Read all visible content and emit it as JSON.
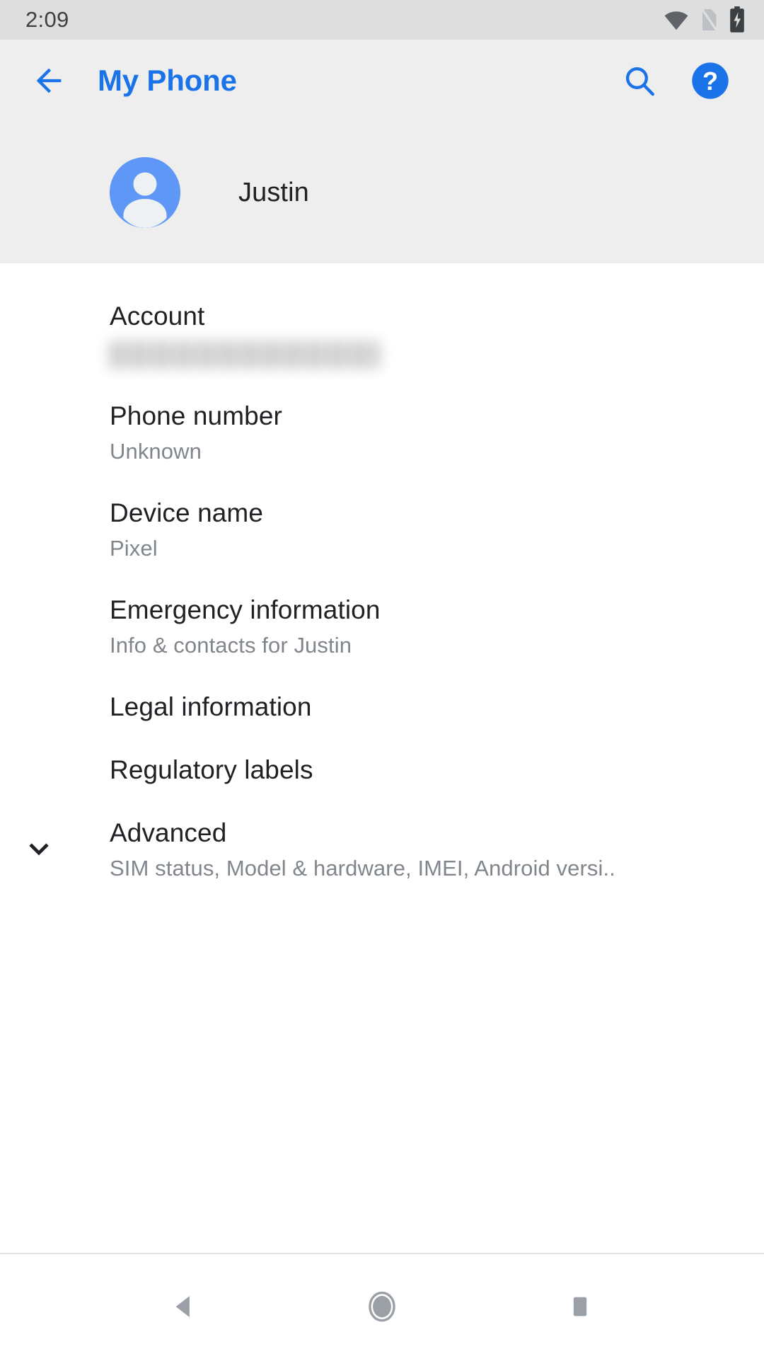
{
  "status_bar": {
    "time": "2:09",
    "icons": [
      {
        "name": "wifi-icon",
        "label": "Wi-Fi connected"
      },
      {
        "name": "sim-off-icon",
        "label": "No SIM"
      },
      {
        "name": "battery-charging-icon",
        "label": "Battery charging"
      }
    ]
  },
  "app_bar": {
    "back_label": "Navigate up",
    "title": "My Phone",
    "search_label": "Search",
    "help_label": "Help",
    "title_color": "#1a73e8"
  },
  "profile": {
    "avatar_name": "person-avatar",
    "name": "Justin",
    "avatar_color": "#5e97f6"
  },
  "settings": {
    "rows": [
      {
        "name": "account",
        "title": "Account",
        "subtitle": "",
        "redacted": true,
        "chevron": false
      },
      {
        "name": "phone-number",
        "title": "Phone number",
        "subtitle": "Unknown",
        "redacted": false,
        "chevron": false
      },
      {
        "name": "device-name",
        "title": "Device name",
        "subtitle": "Pixel",
        "redacted": false,
        "chevron": false
      },
      {
        "name": "emergency-information",
        "title": "Emergency information",
        "subtitle": "Info & contacts for Justin",
        "redacted": false,
        "chevron": false
      },
      {
        "name": "legal-information",
        "title": "Legal information",
        "subtitle": "",
        "redacted": false,
        "chevron": false
      },
      {
        "name": "regulatory-labels",
        "title": "Regulatory labels",
        "subtitle": "",
        "redacted": false,
        "chevron": false
      },
      {
        "name": "advanced",
        "title": "Advanced",
        "subtitle": "SIM status, Model & hardware, IMEI, Android versi..",
        "redacted": false,
        "chevron": true
      }
    ]
  },
  "nav_bar": {
    "back_label": "Back",
    "home_label": "Home",
    "recents_label": "Recent apps"
  }
}
